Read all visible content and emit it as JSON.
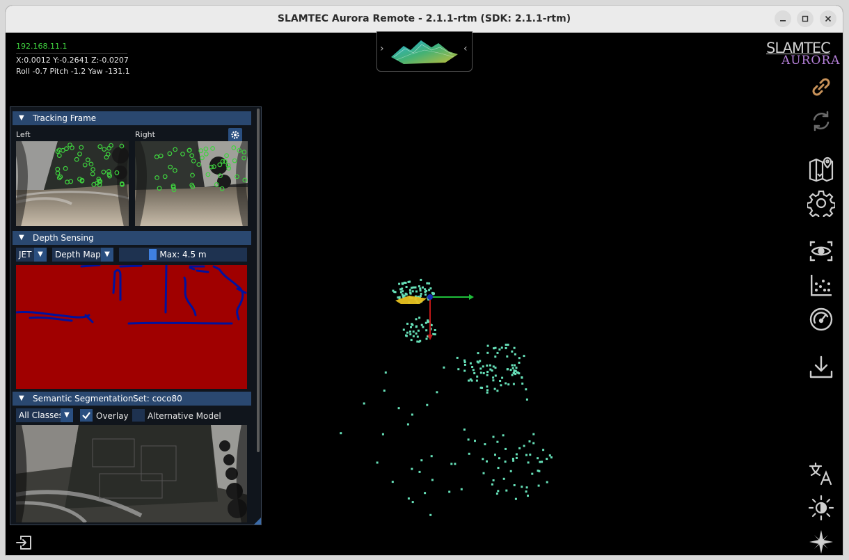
{
  "window": {
    "title": "SLAMTEC Aurora Remote - 2.1.1-rtm (SDK: 2.1.1-rtm)",
    "controls": [
      "minimize",
      "maximize",
      "close"
    ]
  },
  "status": {
    "ip": "192.168.11.1",
    "position": "X:0.0012 Y:-0.2641 Z:-0.0207",
    "orientation": "Roll -0.7 Pitch -1.2 Yaw -131.1"
  },
  "logo": {
    "line1": "SLAMTEC",
    "line2": "AURORA"
  },
  "colors": {
    "accent": "#2a4870",
    "accent_light": "#3f80e0",
    "feature_green": "#3fd23f",
    "map_points": "#66e0b8",
    "depth_red": "#a00000",
    "depth_blue": "#00129e",
    "link_icon": "#c9935a",
    "logo_purple": "#b47fd8"
  },
  "right_toolbar": [
    {
      "icon": "link-icon",
      "enabled": true
    },
    {
      "icon": "refresh-icon",
      "enabled": false
    },
    {
      "icon": "map-pin-icon",
      "enabled": true
    },
    {
      "icon": "gear-icon",
      "enabled": true
    },
    {
      "icon": "camera-eye-icon",
      "enabled": true
    },
    {
      "icon": "scatter-chart-icon",
      "enabled": true
    },
    {
      "icon": "gauge-icon",
      "enabled": true
    },
    {
      "icon": "download-icon",
      "enabled": true
    },
    {
      "icon": "translate-icon",
      "enabled": true
    },
    {
      "icon": "brightness-icon",
      "enabled": true
    },
    {
      "icon": "compass-star-icon",
      "enabled": true
    }
  ],
  "panel": {
    "tracking": {
      "header": "Tracking Frame",
      "left_label": "Left",
      "right_label": "Right"
    },
    "depth": {
      "header": "Depth Sensing",
      "colormap": "JET",
      "mode": "Depth Map",
      "max_label": "Max: 4.5 m"
    },
    "semantic": {
      "header": "Semantic Segmentation",
      "set_label": "Set: coco80",
      "classes": "All Classes",
      "overlay_label": "Overlay",
      "overlay_checked": true,
      "alt_model_label": "Alternative Model",
      "alt_model_checked": false
    }
  }
}
